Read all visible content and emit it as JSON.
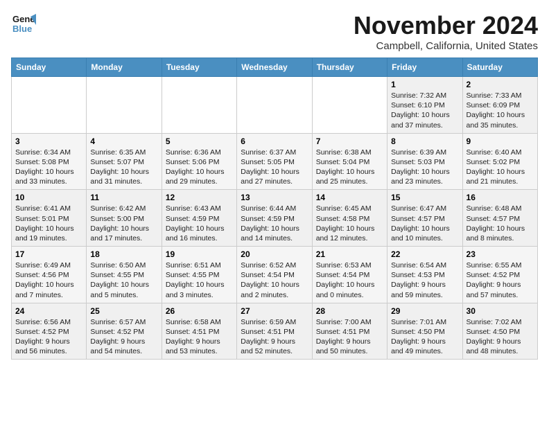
{
  "logo": {
    "line1": "General",
    "line2": "Blue"
  },
  "title": "November 2024",
  "location": "Campbell, California, United States",
  "days_header": [
    "Sunday",
    "Monday",
    "Tuesday",
    "Wednesday",
    "Thursday",
    "Friday",
    "Saturday"
  ],
  "weeks": [
    [
      {
        "day": "",
        "detail": ""
      },
      {
        "day": "",
        "detail": ""
      },
      {
        "day": "",
        "detail": ""
      },
      {
        "day": "",
        "detail": ""
      },
      {
        "day": "",
        "detail": ""
      },
      {
        "day": "1",
        "detail": "Sunrise: 7:32 AM\nSunset: 6:10 PM\nDaylight: 10 hours and 37 minutes."
      },
      {
        "day": "2",
        "detail": "Sunrise: 7:33 AM\nSunset: 6:09 PM\nDaylight: 10 hours and 35 minutes."
      }
    ],
    [
      {
        "day": "3",
        "detail": "Sunrise: 6:34 AM\nSunset: 5:08 PM\nDaylight: 10 hours and 33 minutes."
      },
      {
        "day": "4",
        "detail": "Sunrise: 6:35 AM\nSunset: 5:07 PM\nDaylight: 10 hours and 31 minutes."
      },
      {
        "day": "5",
        "detail": "Sunrise: 6:36 AM\nSunset: 5:06 PM\nDaylight: 10 hours and 29 minutes."
      },
      {
        "day": "6",
        "detail": "Sunrise: 6:37 AM\nSunset: 5:05 PM\nDaylight: 10 hours and 27 minutes."
      },
      {
        "day": "7",
        "detail": "Sunrise: 6:38 AM\nSunset: 5:04 PM\nDaylight: 10 hours and 25 minutes."
      },
      {
        "day": "8",
        "detail": "Sunrise: 6:39 AM\nSunset: 5:03 PM\nDaylight: 10 hours and 23 minutes."
      },
      {
        "day": "9",
        "detail": "Sunrise: 6:40 AM\nSunset: 5:02 PM\nDaylight: 10 hours and 21 minutes."
      }
    ],
    [
      {
        "day": "10",
        "detail": "Sunrise: 6:41 AM\nSunset: 5:01 PM\nDaylight: 10 hours and 19 minutes."
      },
      {
        "day": "11",
        "detail": "Sunrise: 6:42 AM\nSunset: 5:00 PM\nDaylight: 10 hours and 17 minutes."
      },
      {
        "day": "12",
        "detail": "Sunrise: 6:43 AM\nSunset: 4:59 PM\nDaylight: 10 hours and 16 minutes."
      },
      {
        "day": "13",
        "detail": "Sunrise: 6:44 AM\nSunset: 4:59 PM\nDaylight: 10 hours and 14 minutes."
      },
      {
        "day": "14",
        "detail": "Sunrise: 6:45 AM\nSunset: 4:58 PM\nDaylight: 10 hours and 12 minutes."
      },
      {
        "day": "15",
        "detail": "Sunrise: 6:47 AM\nSunset: 4:57 PM\nDaylight: 10 hours and 10 minutes."
      },
      {
        "day": "16",
        "detail": "Sunrise: 6:48 AM\nSunset: 4:57 PM\nDaylight: 10 hours and 8 minutes."
      }
    ],
    [
      {
        "day": "17",
        "detail": "Sunrise: 6:49 AM\nSunset: 4:56 PM\nDaylight: 10 hours and 7 minutes."
      },
      {
        "day": "18",
        "detail": "Sunrise: 6:50 AM\nSunset: 4:55 PM\nDaylight: 10 hours and 5 minutes."
      },
      {
        "day": "19",
        "detail": "Sunrise: 6:51 AM\nSunset: 4:55 PM\nDaylight: 10 hours and 3 minutes."
      },
      {
        "day": "20",
        "detail": "Sunrise: 6:52 AM\nSunset: 4:54 PM\nDaylight: 10 hours and 2 minutes."
      },
      {
        "day": "21",
        "detail": "Sunrise: 6:53 AM\nSunset: 4:54 PM\nDaylight: 10 hours and 0 minutes."
      },
      {
        "day": "22",
        "detail": "Sunrise: 6:54 AM\nSunset: 4:53 PM\nDaylight: 9 hours and 59 minutes."
      },
      {
        "day": "23",
        "detail": "Sunrise: 6:55 AM\nSunset: 4:52 PM\nDaylight: 9 hours and 57 minutes."
      }
    ],
    [
      {
        "day": "24",
        "detail": "Sunrise: 6:56 AM\nSunset: 4:52 PM\nDaylight: 9 hours and 56 minutes."
      },
      {
        "day": "25",
        "detail": "Sunrise: 6:57 AM\nSunset: 4:52 PM\nDaylight: 9 hours and 54 minutes."
      },
      {
        "day": "26",
        "detail": "Sunrise: 6:58 AM\nSunset: 4:51 PM\nDaylight: 9 hours and 53 minutes."
      },
      {
        "day": "27",
        "detail": "Sunrise: 6:59 AM\nSunset: 4:51 PM\nDaylight: 9 hours and 52 minutes."
      },
      {
        "day": "28",
        "detail": "Sunrise: 7:00 AM\nSunset: 4:51 PM\nDaylight: 9 hours and 50 minutes."
      },
      {
        "day": "29",
        "detail": "Sunrise: 7:01 AM\nSunset: 4:50 PM\nDaylight: 9 hours and 49 minutes."
      },
      {
        "day": "30",
        "detail": "Sunrise: 7:02 AM\nSunset: 4:50 PM\nDaylight: 9 hours and 48 minutes."
      }
    ]
  ]
}
